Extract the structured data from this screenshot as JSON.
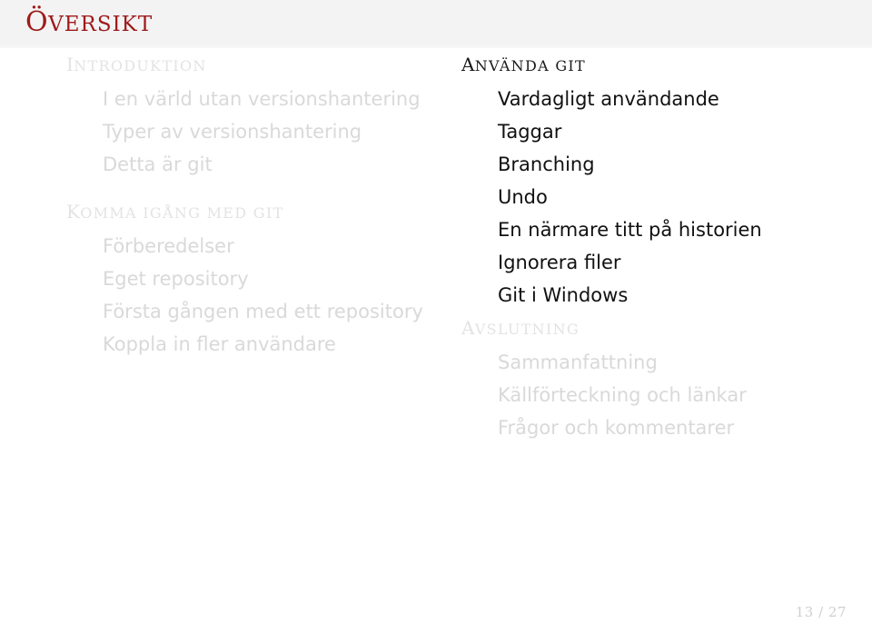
{
  "header": {
    "title": "ÖVERSIKT",
    "title_first": "Ö",
    "title_rest": "VERSIKT",
    "title_color": "#9e1a1a",
    "band_color": "#f3f3f3"
  },
  "columns": {
    "left": {
      "sections": [
        {
          "title": "INTRODUKTION",
          "title_first": "I",
          "title_rest": "NTRODUKTION",
          "state": "inactive",
          "items": [
            "I en värld utan versionshantering",
            "Typer av versionshantering",
            "Detta är git"
          ]
        },
        {
          "title": "KOMMA IGÅNG MED GIT",
          "title_first": "K",
          "title_rest": "OMMA IGÅNG MED GIT",
          "state": "inactive",
          "items": [
            "Förberedelser",
            "Eget repository",
            "Första gången med ett repository",
            "Koppla in fler användare"
          ]
        }
      ]
    },
    "right": {
      "sections": [
        {
          "title": "ANVÄNDA GIT",
          "title_first": "A",
          "title_rest": "NVÄNDA GIT",
          "state": "active",
          "items": [
            "Vardagligt användande",
            "Taggar",
            "Branching",
            "Undo",
            "En närmare titt på historien",
            "Ignorera filer",
            "Git i Windows"
          ]
        },
        {
          "title": "AVSLUTNING",
          "title_first": "A",
          "title_rest": "VSLUTNING",
          "state": "inactive",
          "items": [
            "Sammanfattning",
            "Källförteckning och länkar",
            "Frågor och kommentarer"
          ]
        }
      ]
    }
  },
  "footer": {
    "page_number": "13 / 27",
    "current_page": 13,
    "total_pages": 27
  }
}
